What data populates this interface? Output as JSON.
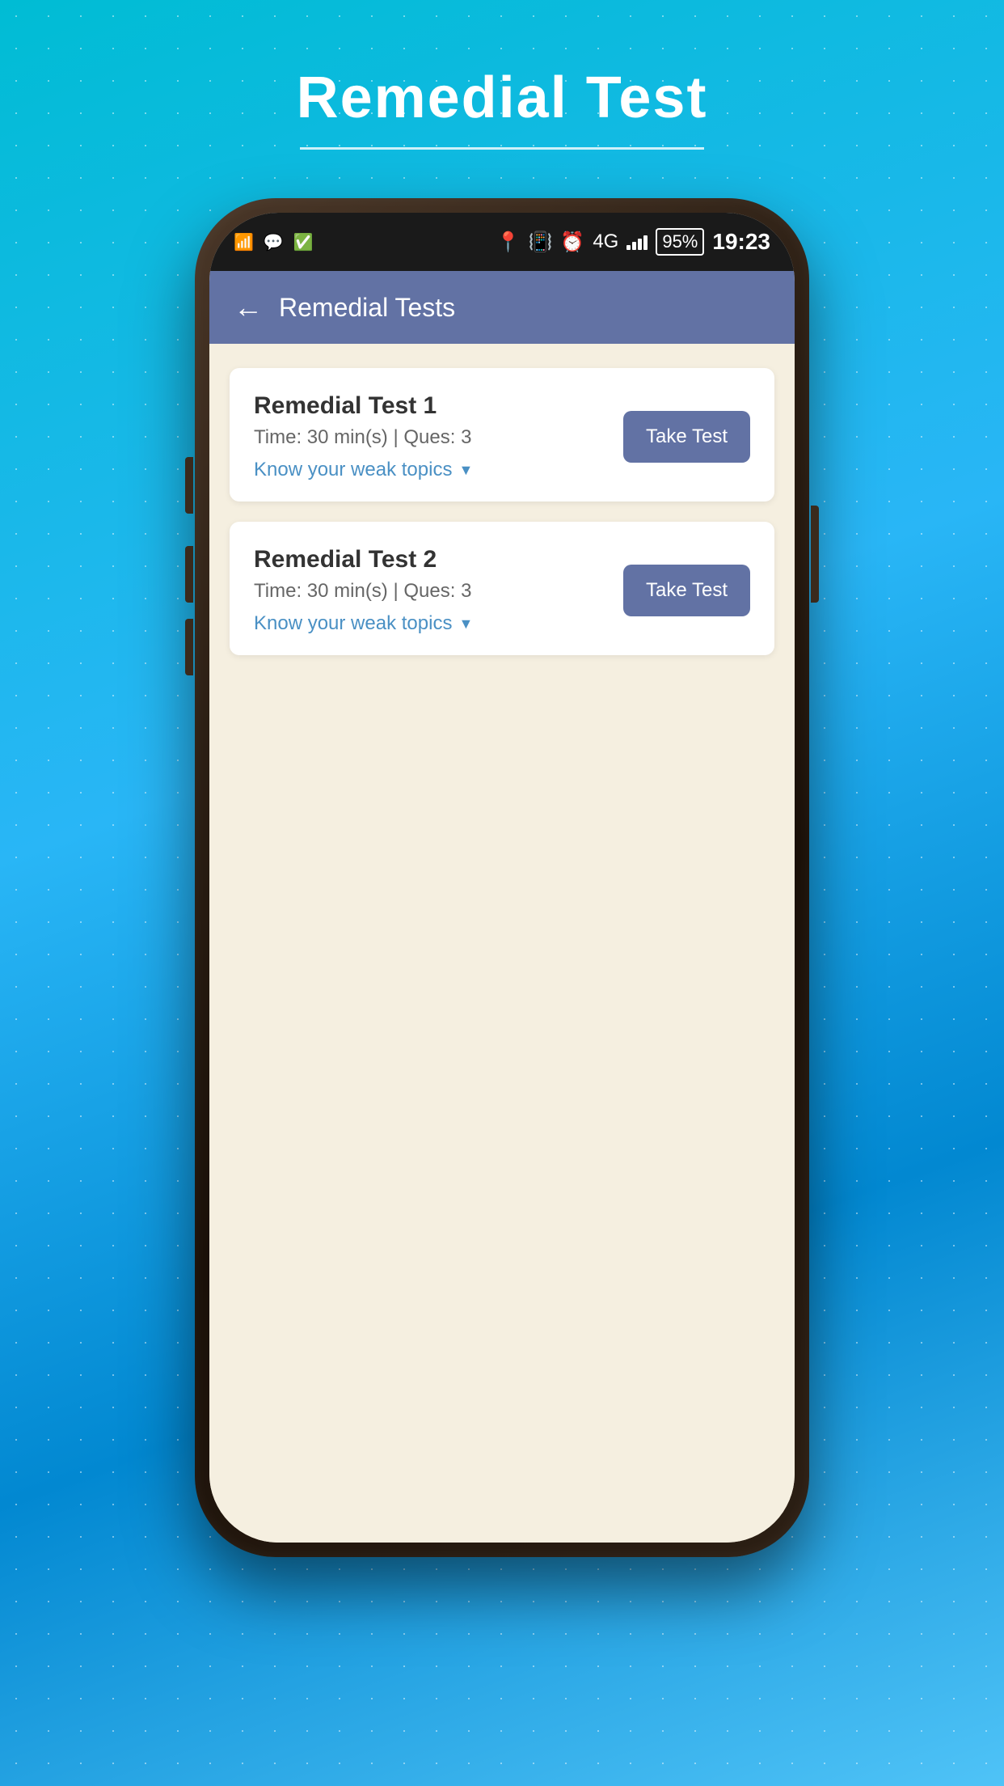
{
  "page": {
    "title": "Remedial Test",
    "title_underline": true
  },
  "status_bar": {
    "time": "19:23",
    "battery_percent": "95%",
    "network": "4G",
    "icons": [
      "wifi",
      "chat",
      "checkmark",
      "location",
      "vibrate",
      "alarm",
      "signal"
    ]
  },
  "app_header": {
    "back_label": "←",
    "title": "Remedial Tests"
  },
  "tests": [
    {
      "id": 1,
      "name": "Remedial Test 1",
      "time": "Time: 30 min(s) | Ques: 3",
      "weak_topics_label": "Know your weak topics",
      "button_label": "Take Test"
    },
    {
      "id": 2,
      "name": "Remedial Test 2",
      "time": "Time: 30 min(s) | Ques: 3",
      "weak_topics_label": "Know your weak topics",
      "button_label": "Take Test"
    }
  ],
  "colors": {
    "header_bg": "#6272a4",
    "button_bg": "#6272a4",
    "link_color": "#4a90c4",
    "content_bg": "#f5efe0",
    "card_bg": "#ffffff"
  }
}
